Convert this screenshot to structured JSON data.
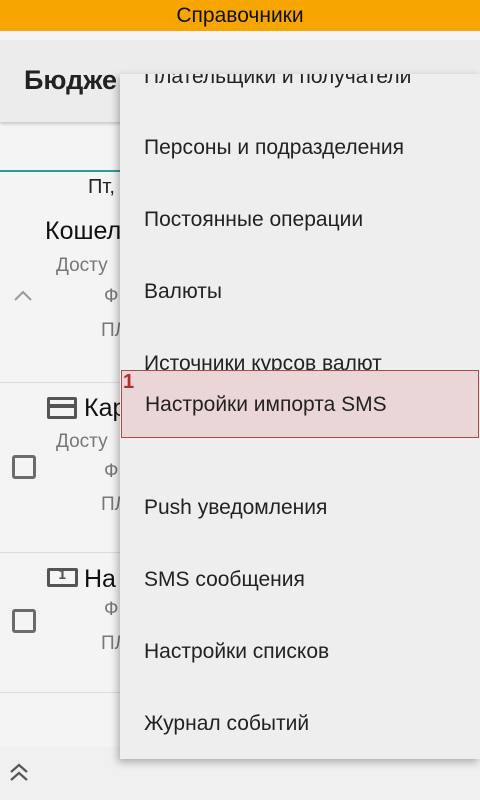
{
  "banner": {
    "title": "Справочники"
  },
  "toolbar": {
    "title": "Бюдже"
  },
  "list": {
    "column_header": "Пт,",
    "wallet": {
      "title": "Кошел",
      "subtitle": "Досту",
      "f_label": "Ф",
      "p_label": "ПЛ"
    },
    "card": {
      "title": "Кар",
      "subtitle": "Досту",
      "f_label": "Ф",
      "p_label": "ПЛ"
    },
    "cash": {
      "title": "На",
      "f_label": "Ф",
      "p_label": "ПЛ"
    }
  },
  "menu": {
    "items": [
      {
        "label": "Плательщики и получатели"
      },
      {
        "label": "Персоны и подразделения"
      },
      {
        "label": "Постоянные операции"
      },
      {
        "label": "Валюты"
      },
      {
        "label": "Источники курсов валют"
      },
      {
        "label": "Настройки импорта SMS",
        "marker": "1"
      },
      {
        "label": "Push уведомления"
      },
      {
        "label": "SMS сообщения"
      },
      {
        "label": "Настройки списков"
      },
      {
        "label": "Журнал событий"
      }
    ]
  },
  "colors": {
    "banner": "#f7a500",
    "accent": "#2a9d94",
    "highlight": "#ead6d6",
    "marker": "#b03030"
  }
}
